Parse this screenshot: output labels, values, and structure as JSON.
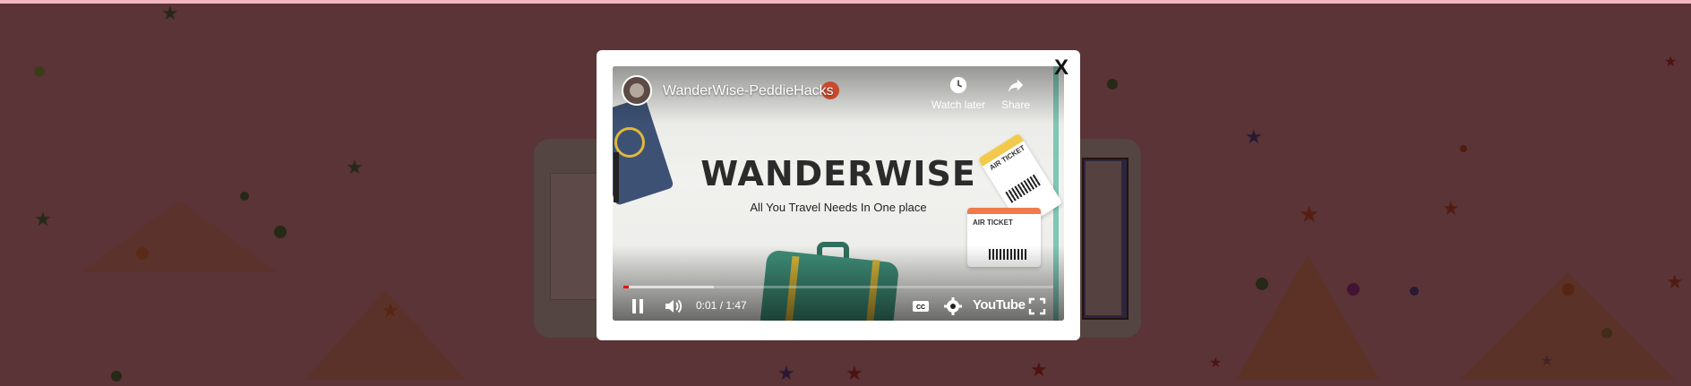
{
  "modal": {
    "close_label": "X"
  },
  "video": {
    "title": "WanderWise-PeddieHacks",
    "watch_later_label": "Watch later",
    "share_label": "Share",
    "slide_title": "WANDERWISE",
    "slide_subtitle": "All You Travel Needs In One place",
    "time_display": "0:01 / 1:47",
    "progress_fraction": 0.009,
    "buffered_fraction": 0.21,
    "youtube_logo": "YouTube",
    "ticket_label_1": "AIR TICKET",
    "ticket_label_2": "AIR TICKET"
  },
  "controls": {
    "play_state": "playing",
    "icons": [
      "pause-icon",
      "volume-icon",
      "captions-icon",
      "settings-icon",
      "fullscreen-icon"
    ]
  },
  "colors": {
    "overlay": "#2a0c0c",
    "progress_played": "#ff0000",
    "modal_bg": "#ffffff"
  }
}
